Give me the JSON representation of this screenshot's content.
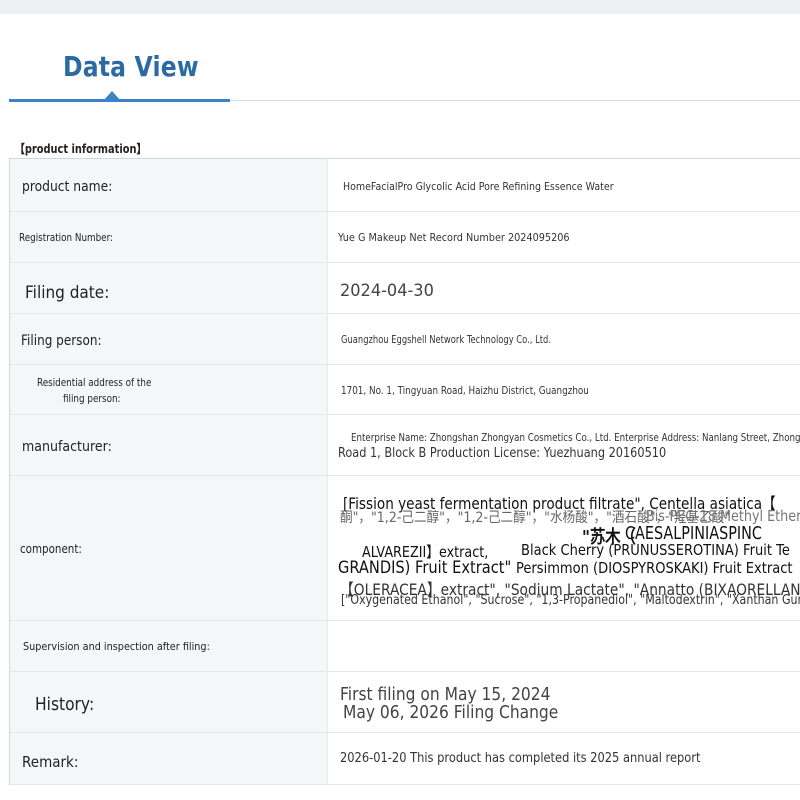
{
  "tab": {
    "title": "Data View"
  },
  "section": {
    "title": "【product information】"
  },
  "fields": {
    "product_name": {
      "label": "product name:",
      "value": "HomeFacialPro Glycolic Acid Pore Refining Essence Water"
    },
    "registration_number": {
      "label": "Registration Number:",
      "value": "Yue G Makeup Net Record Number 2024095206"
    },
    "filing_date": {
      "label": "Filing date:",
      "value": "2024-04-30"
    },
    "filing_person": {
      "label": "Filing person:",
      "value": "Guangzhou Eggshell Network Technology Co., Ltd."
    },
    "residential_address": {
      "label_line1": "Residential address of the",
      "label_line2": "filing person:",
      "value": "1701, No. 1, Tingyuan Road, Haizhu District, Guangzhou"
    },
    "manufacturer": {
      "label": "manufacturer:",
      "value_line1": "Enterprise Name: Zhongshan Zhongyan Cosmetics Co., Ltd. Enterprise Address: Nanlang Street, Zhongshan",
      "value_line2": "Road 1, Block B Production License: Yuezhuang 20160510"
    },
    "component": {
      "label": "component:",
      "line1": "[Fission yeast fermentation product filtrate\", Centella asiatica【",
      "line2a": "酮\"，\"1,2-己二醇\"，\"1,2-己二醇\"，\"水杨酸\"，\"酒石酸\"，\"羟基乙酸\"",
      "line2b": "Bis-PEG-18 Methyl Ether",
      "line3a": "\"苏木（",
      "line3b": "CAESALPINIASPINC",
      "line4a": "ALVAREZII】extract,",
      "line4b": "Black Cherry (PRUNUSSEROTINA) Fruit Te",
      "line5a": "GRANDIS) Fruit Extract\"",
      "line5b": "Persimmon (DIOSPYROSKAKI) Fruit Extract",
      "line6": "【OLERACEA】extract\", \"Sodium Lactate\", \"Annatto (BIXAORELLANA)\"",
      "line7": "[\"Oxygenated Ethanol\", \"Sucrose\", \"1,3-Propanediol\", \"Maltodextrin\", \"Xanthan Gum\"]"
    },
    "supervision": {
      "label": "Supervision and inspection after filing:",
      "value": ""
    },
    "history": {
      "label": "History:",
      "line1": "First filing on May 15, 2024",
      "line2": "May 06, 2026 Filing Change"
    },
    "remark": {
      "label": "Remark:",
      "value": "2026-01-20 This product has completed its 2025 annual report"
    }
  },
  "colors": {
    "accent": "#3d82c4",
    "title": "#2c6aa3",
    "label_bg": "#f5f6f8",
    "border": "#c9d9ea"
  }
}
